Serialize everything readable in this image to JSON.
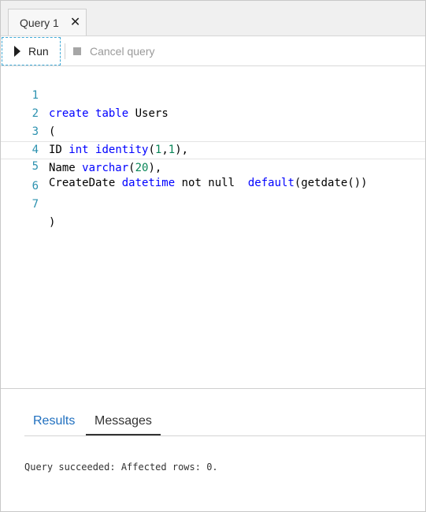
{
  "tabs": [
    {
      "label": "Query 1",
      "close_glyph": "✕",
      "active": true
    }
  ],
  "toolbar": {
    "run_label": "Run",
    "run_icon": "play-icon",
    "cancel_label": "Cancel query",
    "cancel_icon": "stop-icon",
    "cancel_enabled": false
  },
  "editor": {
    "current_line": 5,
    "lines": [
      {
        "number": "1",
        "text": "create table Users"
      },
      {
        "number": "2",
        "text": "("
      },
      {
        "number": "3",
        "text": "ID int identity(1,1),"
      },
      {
        "number": "4",
        "text": "Name varchar(20),"
      },
      {
        "number": "5",
        "text": "CreateDate datetime not null  default(getdate())"
      },
      {
        "number": "6",
        "text": ""
      },
      {
        "number": "7",
        "text": ")"
      }
    ]
  },
  "results_panel": {
    "tabs": [
      {
        "label": "Results",
        "active": false
      },
      {
        "label": "Messages",
        "active": true
      }
    ],
    "message": "Query succeeded: Affected rows: 0."
  },
  "colors": {
    "keyword": "#0000ff",
    "number_literal": "#098658",
    "line_number": "#2b91af",
    "run_focus_border": "#3fa9d6",
    "results_tab_link": "#1f6fbf"
  }
}
